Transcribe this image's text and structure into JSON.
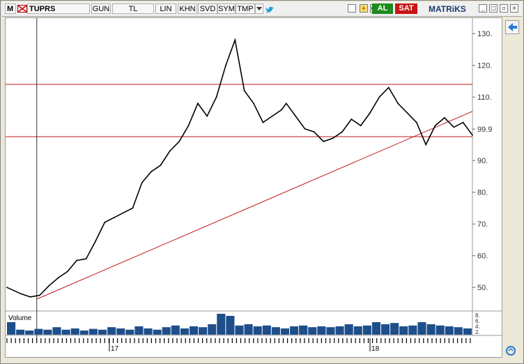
{
  "toolbar": {
    "menu_letter": "M",
    "symbol": "TUPRS",
    "items": [
      "GUN",
      "TL",
      "LIN",
      "KHN",
      "SVD",
      "SYM",
      "TMP"
    ],
    "buy_label": "AL",
    "sell_label": "SAT",
    "brand": "MATRiKS"
  },
  "chart_data": {
    "type": "line",
    "title": "",
    "xlabel": "",
    "ylabel": "",
    "x_tick_labels": [
      "17",
      "18"
    ],
    "y_tick_labels": [
      "50.",
      "60.",
      "70.",
      "80.",
      "90.",
      "99.9",
      "110.",
      "120.",
      "130."
    ],
    "ylim": [
      43,
      134
    ],
    "grid": false,
    "volume_label": "Volume",
    "volume_ticks": [
      "8.",
      "6.",
      "4.",
      "2."
    ],
    "horizontal_lines": [
      114.0,
      97.5
    ],
    "trendline": {
      "from": [
        0.064,
        46.3
      ],
      "to": [
        1.0,
        105.5
      ]
    },
    "series": [
      {
        "x": [
          0.0,
          0.03,
          0.05,
          0.07,
          0.09,
          0.11,
          0.13,
          0.15,
          0.17,
          0.19,
          0.21,
          0.23,
          0.25,
          0.27,
          0.29,
          0.31,
          0.33,
          0.35,
          0.37,
          0.39,
          0.41,
          0.43,
          0.45,
          0.47,
          0.49,
          0.51,
          0.53,
          0.55,
          0.57,
          0.59,
          0.6,
          0.62,
          0.64,
          0.66,
          0.68,
          0.7,
          0.72,
          0.74,
          0.76,
          0.78,
          0.8,
          0.82,
          0.84,
          0.86,
          0.88,
          0.9,
          0.92,
          0.94,
          0.96,
          0.98,
          1.0
        ],
        "values": [
          50.0,
          48.0,
          47.0,
          47.5,
          50.5,
          53.0,
          55.0,
          58.5,
          59.0,
          64.5,
          70.5,
          72.0,
          73.5,
          75.0,
          83.0,
          86.5,
          88.5,
          93.0,
          96.0,
          101.0,
          108.0,
          104.0,
          110.0,
          120.0,
          128.0,
          112.0,
          108.0,
          102.0,
          104.0,
          106.0,
          108.0,
          104.0,
          100.0,
          99.0,
          96.0,
          97.0,
          99.0,
          103.0,
          101.0,
          105.0,
          110.0,
          113.0,
          108.0,
          105.0,
          102.0,
          95.0,
          101.0,
          103.5,
          100.5,
          102.0,
          98.0
        ],
        "volume": [
          0.3,
          0.12,
          0.1,
          0.14,
          0.12,
          0.18,
          0.12,
          0.15,
          0.1,
          0.14,
          0.12,
          0.18,
          0.15,
          0.12,
          0.2,
          0.15,
          0.12,
          0.18,
          0.22,
          0.15,
          0.2,
          0.18,
          0.25,
          0.5,
          0.45,
          0.22,
          0.25,
          0.2,
          0.22,
          0.18,
          0.15,
          0.2,
          0.22,
          0.18,
          0.2,
          0.18,
          0.2,
          0.25,
          0.2,
          0.22,
          0.3,
          0.25,
          0.28,
          0.2,
          0.22,
          0.3,
          0.25,
          0.22,
          0.2,
          0.18,
          0.15
        ]
      }
    ]
  }
}
